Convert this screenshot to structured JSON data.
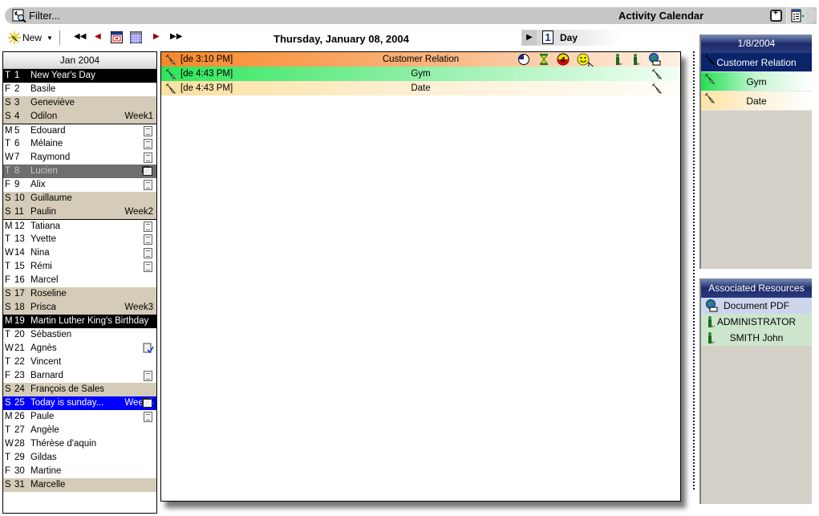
{
  "filter_bar": {
    "filter_label": "Filter...",
    "title": "Activity Calendar"
  },
  "toolbar": {
    "new_label": "New",
    "nav": [
      "first-icon",
      "prev-icon",
      "today-icon",
      "month-view-icon",
      "next-icon",
      "last-icon"
    ]
  },
  "header": {
    "current_date": "Thursday, January 08, 2004",
    "view_number": "1",
    "view_label": "Day"
  },
  "month_list": {
    "title": "Jan 2004",
    "days": [
      {
        "dow": "T",
        "num": "1",
        "name": "New Year's Day",
        "style": "holiday"
      },
      {
        "dow": "F",
        "num": "2",
        "name": "Basile",
        "style": "white"
      },
      {
        "dow": "S",
        "num": "3",
        "name": "Geneviève",
        "style": "weekend"
      },
      {
        "dow": "S",
        "num": "4",
        "name": "Odilon",
        "style": "weekend",
        "week": "Week1"
      },
      {
        "dow": "M",
        "num": "5",
        "name": "Edouard",
        "style": "white",
        "icon": "note",
        "sep": true
      },
      {
        "dow": "T",
        "num": "6",
        "name": "Mélaine",
        "style": "white",
        "icon": "note"
      },
      {
        "dow": "W",
        "num": "7",
        "name": "Raymond",
        "style": "white",
        "icon": "note"
      },
      {
        "dow": "T",
        "num": "8",
        "name": "Lucien",
        "style": "selected",
        "icon": "multi"
      },
      {
        "dow": "F",
        "num": "9",
        "name": "Alix",
        "style": "white",
        "icon": "note"
      },
      {
        "dow": "S",
        "num": "10",
        "name": "Guillaume",
        "style": "weekend"
      },
      {
        "dow": "S",
        "num": "11",
        "name": "Paulin",
        "style": "weekend",
        "week": "Week2"
      },
      {
        "dow": "M",
        "num": "12",
        "name": "Tatiana",
        "style": "white",
        "icon": "note",
        "sep": true
      },
      {
        "dow": "T",
        "num": "13",
        "name": "Yvette",
        "style": "white",
        "icon": "note"
      },
      {
        "dow": "W",
        "num": "14",
        "name": "Nina",
        "style": "white",
        "icon": "note"
      },
      {
        "dow": "T",
        "num": "15",
        "name": "Rémi",
        "style": "white",
        "icon": "note"
      },
      {
        "dow": "F",
        "num": "16",
        "name": "Marcel",
        "style": "white"
      },
      {
        "dow": "S",
        "num": "17",
        "name": "Roseline",
        "style": "weekend"
      },
      {
        "dow": "S",
        "num": "18",
        "name": "Prisca",
        "style": "weekend",
        "week": "Week3"
      },
      {
        "dow": "M",
        "num": "19",
        "name": "Martin Luther King's Birthday",
        "style": "holiday"
      },
      {
        "dow": "T",
        "num": "20",
        "name": "Sébastien",
        "style": "white"
      },
      {
        "dow": "W",
        "num": "21",
        "name": "Agnès",
        "style": "white",
        "icon": "check"
      },
      {
        "dow": "T",
        "num": "22",
        "name": "Vincent",
        "style": "white"
      },
      {
        "dow": "F",
        "num": "23",
        "name": "Barnard",
        "style": "white",
        "icon": "note"
      },
      {
        "dow": "S",
        "num": "24",
        "name": "François de Sales",
        "style": "weekend"
      },
      {
        "dow": "S",
        "num": "25",
        "name": "Today is sunday...",
        "style": "today",
        "week": "Week4",
        "icon": "multi"
      },
      {
        "dow": "M",
        "num": "26",
        "name": "Paule",
        "style": "white",
        "icon": "note"
      },
      {
        "dow": "T",
        "num": "27",
        "name": "Angèle",
        "style": "white"
      },
      {
        "dow": "W",
        "num": "28",
        "name": "Thérèse d'aquin",
        "style": "white"
      },
      {
        "dow": "T",
        "num": "29",
        "name": "Gildas",
        "style": "white"
      },
      {
        "dow": "F",
        "num": "30",
        "name": "Martine",
        "style": "white"
      },
      {
        "dow": "S",
        "num": "31",
        "name": "Marcelle",
        "style": "weekend"
      }
    ]
  },
  "appointments": [
    {
      "time": "[de 3:10 PM]",
      "subject": "Customer Relation",
      "color": "#f5892a",
      "icons": [
        "progress-pie-icon",
        "hourglass-icon",
        "priority-4-icon",
        "smiley-icon",
        "person-icon",
        "person-icon",
        "document-globe-icon"
      ]
    },
    {
      "time": "[de 4:43 PM]",
      "subject": "Gym",
      "color": "#2ee65a",
      "icons": [
        "pin-icon"
      ]
    },
    {
      "time": "[de 4:43 PM]",
      "subject": "Date",
      "color": "#fbe0a0",
      "icons": [
        "pin-icon"
      ]
    }
  ],
  "day_summary": {
    "date": "1/8/2004",
    "items": [
      "Customer Relation",
      "Gym",
      "Date"
    ]
  },
  "resources": {
    "title": "Associated Resources",
    "items": [
      {
        "label": "Document PDF",
        "icon": "document-globe-icon"
      },
      {
        "label": "ADMINISTRATOR",
        "icon": "person-icon"
      },
      {
        "label": "SMITH John",
        "icon": "person-icon"
      }
    ]
  }
}
